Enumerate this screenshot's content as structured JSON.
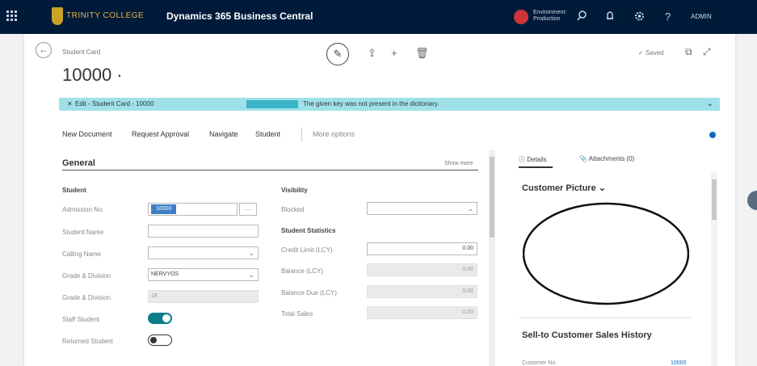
{
  "topbar": {
    "college": "TRINITY COLLEGE",
    "app_name": "Dynamics 365 Business Central",
    "environment": [
      "Environment:",
      "Production"
    ],
    "user": "ADMIN",
    "icons": [
      "app-launcher-icon",
      "search-icon",
      "notification-icon",
      "gear-icon",
      "help-icon"
    ],
    "help": "?"
  },
  "header": {
    "caption": "Student Card",
    "record": "10000 ·",
    "saved": "✓ Saved",
    "back": "←",
    "edit": "✎",
    "share": "⇪",
    "new": "+",
    "delete": "🗑",
    "open_new": "⧉",
    "collapse": "⤢"
  },
  "error": {
    "close": "✕",
    "title": "Edit - Student Card - 10000",
    "message": "The given key was not present in the dictionary.",
    "expand": "⌄"
  },
  "actions": {
    "new_document": "New Document",
    "request_approval": "Request Approval",
    "navigate": "Navigate",
    "student": "Student",
    "more": "More options"
  },
  "general": {
    "title": "General",
    "show_more": "Show more",
    "student_heading": "Student",
    "admission_no": {
      "label": "Admission No.",
      "value": "10000"
    },
    "student_name": {
      "label": "Student Name",
      "value": ""
    },
    "calling_name": {
      "label": "Calling Name",
      "value": ""
    },
    "grade_division_1": {
      "label": "Grade & Division",
      "value": "NERVYOS"
    },
    "grade_division_2": {
      "label": "Grade & Division",
      "value": "1E"
    },
    "staff_student": {
      "label": "Staff Student",
      "on": true
    },
    "returned_student": {
      "label": "Returned Student",
      "on": false
    },
    "visibility_heading": "Visibility",
    "blocked": {
      "label": "Blocked",
      "value": ""
    },
    "stats_heading": "Student Statistics",
    "credit_limit": {
      "label": "Credit Limit (LCY)",
      "value": "0.00"
    },
    "balance": {
      "label": "Balance (LCY)",
      "value": "0.00"
    },
    "balance_due": {
      "label": "Balance Due (LCY)",
      "value": "0.00"
    },
    "total_sales": {
      "label": "Total Sales",
      "value": "0.00"
    }
  },
  "factbox": {
    "tab_details": "ⓘ Details",
    "tab_attachments": "📎 Attachments (0)",
    "picture_title": "Customer Picture ⌄",
    "history_title": "Sell-to Customer Sales History",
    "customer_no_label": "Customer No.",
    "customer_no_value": "10000"
  },
  "dropdown_arrow": "⌄",
  "ellipsis": "…",
  "colors": {
    "topbar": "#001b3a",
    "error_bg": "#9fe1e9",
    "toggle_on": "#087e8b",
    "accent": "#0f6cbd"
  }
}
